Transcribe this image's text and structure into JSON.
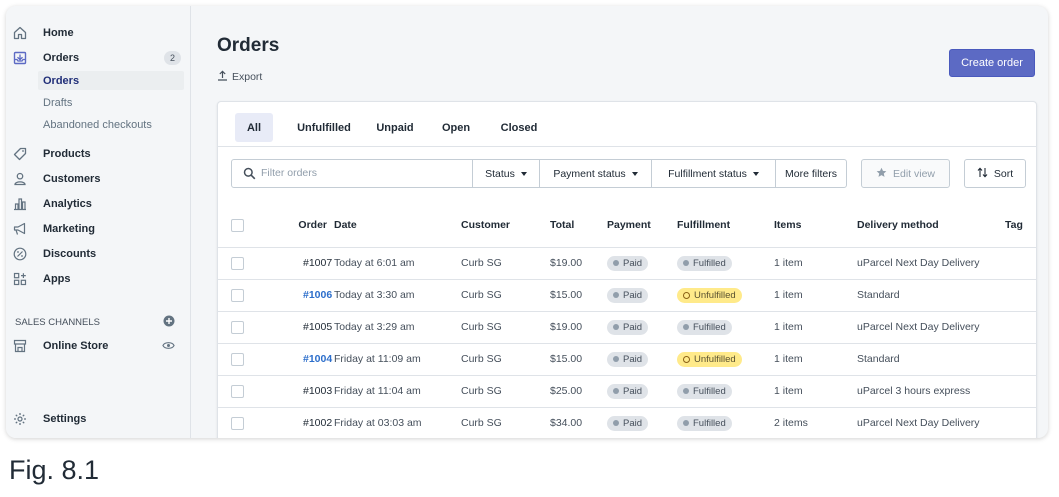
{
  "sidebar": {
    "nav": [
      {
        "label": "Home",
        "icon": "home-icon"
      },
      {
        "label": "Orders",
        "icon": "orders-icon",
        "badge": "2"
      },
      {
        "label": "Products",
        "icon": "tag-icon"
      },
      {
        "label": "Customers",
        "icon": "person-icon"
      },
      {
        "label": "Analytics",
        "icon": "bar-chart-icon"
      },
      {
        "label": "Marketing",
        "icon": "megaphone-icon"
      },
      {
        "label": "Discounts",
        "icon": "percent-icon"
      },
      {
        "label": "Apps",
        "icon": "apps-icon"
      }
    ],
    "orders_sub": [
      "Orders",
      "Drafts",
      "Abandoned checkouts"
    ],
    "sales_channels_title": "SALES CHANNELS",
    "online_store": "Online Store",
    "settings": "Settings"
  },
  "header": {
    "title": "Orders",
    "export_label": "Export",
    "create_label": "Create order"
  },
  "tabs": [
    "All",
    "Unfulfilled",
    "Unpaid",
    "Open",
    "Closed"
  ],
  "filters": {
    "search_placeholder": "Filter orders",
    "status": "Status",
    "payment_status": "Payment status",
    "fulfillment_status": "Fulfillment status",
    "more_filters": "More filters",
    "edit_view": "Edit view",
    "sort": "Sort"
  },
  "table": {
    "headers": [
      "Order",
      "Date",
      "Customer",
      "Total",
      "Payment",
      "Fulfillment",
      "Items",
      "Delivery method",
      "Tag"
    ],
    "rows": [
      {
        "order": "#1007",
        "date": "Today at 6:01 am",
        "customer": "Curb SG",
        "total": "$19.00",
        "payment": "Paid",
        "fulfillment": "Fulfilled",
        "items": "1 item",
        "delivery": "uParcel Next Day Delivery"
      },
      {
        "order": "#1006",
        "date": "Today at 3:30 am",
        "customer": "Curb SG",
        "total": "$15.00",
        "payment": "Paid",
        "fulfillment": "Unfulfilled",
        "items": "1 item",
        "delivery": "Standard"
      },
      {
        "order": "#1005",
        "date": "Today at 3:29 am",
        "customer": "Curb SG",
        "total": "$19.00",
        "payment": "Paid",
        "fulfillment": "Fulfilled",
        "items": "1 item",
        "delivery": "uParcel Next Day Delivery"
      },
      {
        "order": "#1004",
        "date": "Friday at 11:09 am",
        "customer": "Curb SG",
        "total": "$15.00",
        "payment": "Paid",
        "fulfillment": "Unfulfilled",
        "items": "1 item",
        "delivery": "Standard"
      },
      {
        "order": "#1003",
        "date": "Friday at 11:04 am",
        "customer": "Curb SG",
        "total": "$25.00",
        "payment": "Paid",
        "fulfillment": "Fulfilled",
        "items": "1 item",
        "delivery": "uParcel 3 hours express"
      },
      {
        "order": "#1002",
        "date": "Friday at 03:03 am",
        "customer": "Curb SG",
        "total": "$34.00",
        "payment": "Paid",
        "fulfillment": "Fulfilled",
        "items": "2 items",
        "delivery": "uParcel Next Day Delivery"
      }
    ]
  },
  "caption": "Fig. 8.1",
  "colors": {
    "accent": "#5c6ac4",
    "link": "#2c6ecb",
    "warning_badge": "#ffea8a",
    "sidebar_bg": "#f4f6f8"
  }
}
